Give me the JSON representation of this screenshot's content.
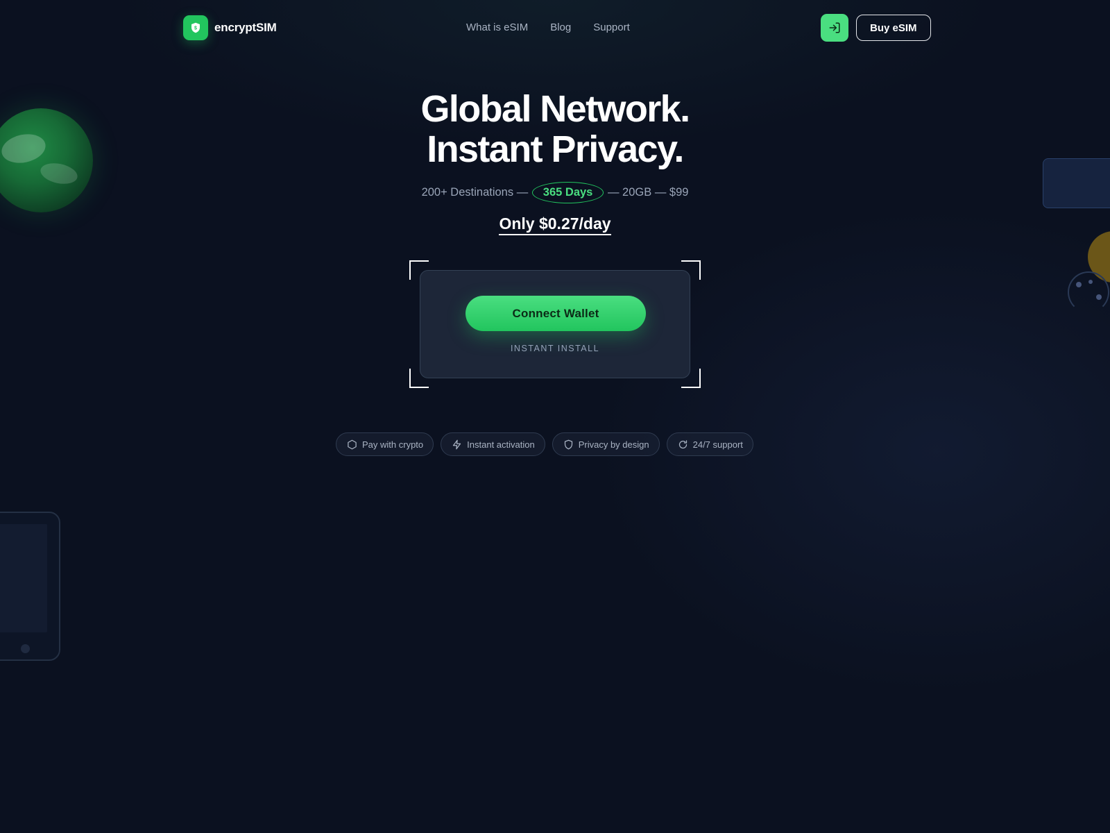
{
  "brand": {
    "name": "encryptSIM",
    "logo_icon": "shield-icon",
    "accent": "#22c55e"
  },
  "nav": {
    "items": [
      {
        "label": "What is eSIM"
      },
      {
        "label": "Blog"
      },
      {
        "label": "Support"
      }
    ]
  },
  "header_actions": {
    "login_icon": "login-icon",
    "buy_label": "Buy eSIM"
  },
  "hero": {
    "title_line1": "Global Network.",
    "title_line2": "Instant Privacy.",
    "destinations": "200+ Destinations",
    "separator": " — ",
    "duration": "365 Days",
    "data": "20GB",
    "price": "$99",
    "daily_price": "Only $0.27/day"
  },
  "wallet": {
    "connect_label": "Connect Wallet",
    "install_label": "INSTANT INSTALL"
  },
  "features": [
    {
      "icon": "hexagon-icon",
      "label": "Pay with crypto"
    },
    {
      "icon": "lightning-icon",
      "label": "Instant activation"
    },
    {
      "icon": "shield-icon",
      "label": "Privacy by design"
    },
    {
      "icon": "refresh-icon",
      "label": "24/7 support"
    }
  ],
  "colors": {
    "background": "#0b1120",
    "primary_button": "#4ade80",
    "pill_border": "#22c55e",
    "coin": "#6b5618"
  }
}
